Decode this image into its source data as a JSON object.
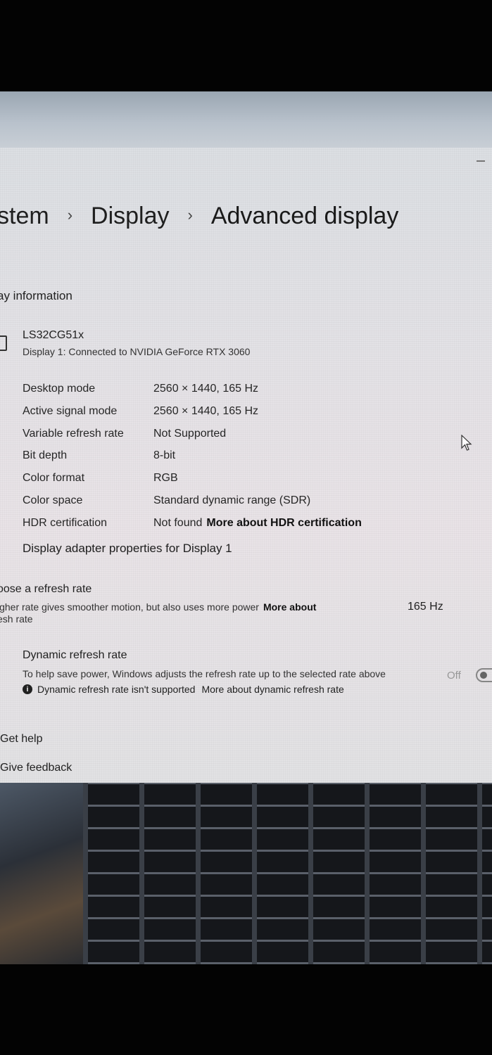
{
  "breadcrumb": [
    "stem",
    "Display",
    "Advanced display"
  ],
  "section_heading": "ay information",
  "display": {
    "name": "LS32CG51x",
    "subtitle": "Display 1: Connected to NVIDIA GeForce RTX 3060"
  },
  "info_rows": [
    {
      "label": "Desktop mode",
      "value": "2560 × 1440, 165 Hz"
    },
    {
      "label": "Active signal mode",
      "value": "2560 × 1440, 165 Hz"
    },
    {
      "label": "Variable refresh rate",
      "value": "Not Supported"
    },
    {
      "label": "Bit depth",
      "value": "8-bit"
    },
    {
      "label": "Color format",
      "value": "RGB"
    },
    {
      "label": "Color space",
      "value": "Standard dynamic range (SDR)"
    },
    {
      "label": "HDR certification",
      "value": "Not found",
      "link": "More about HDR certification"
    }
  ],
  "adapter_link": "Display adapter properties for Display 1",
  "refresh": {
    "title": "oose a refresh rate",
    "description": "igher rate gives smoother motion, but also uses more power",
    "link": "More about",
    "description2": "esh rate",
    "selected": "165 Hz"
  },
  "dynamic_refresh": {
    "title": "Dynamic refresh rate",
    "description": "To help save power, Windows adjusts the refresh rate up to the selected rate above",
    "state": "Off",
    "note": "Dynamic refresh rate isn't supported",
    "note_link": "More about dynamic refresh rate"
  },
  "footer": {
    "help": "Get help",
    "feedback": "Give feedback"
  }
}
